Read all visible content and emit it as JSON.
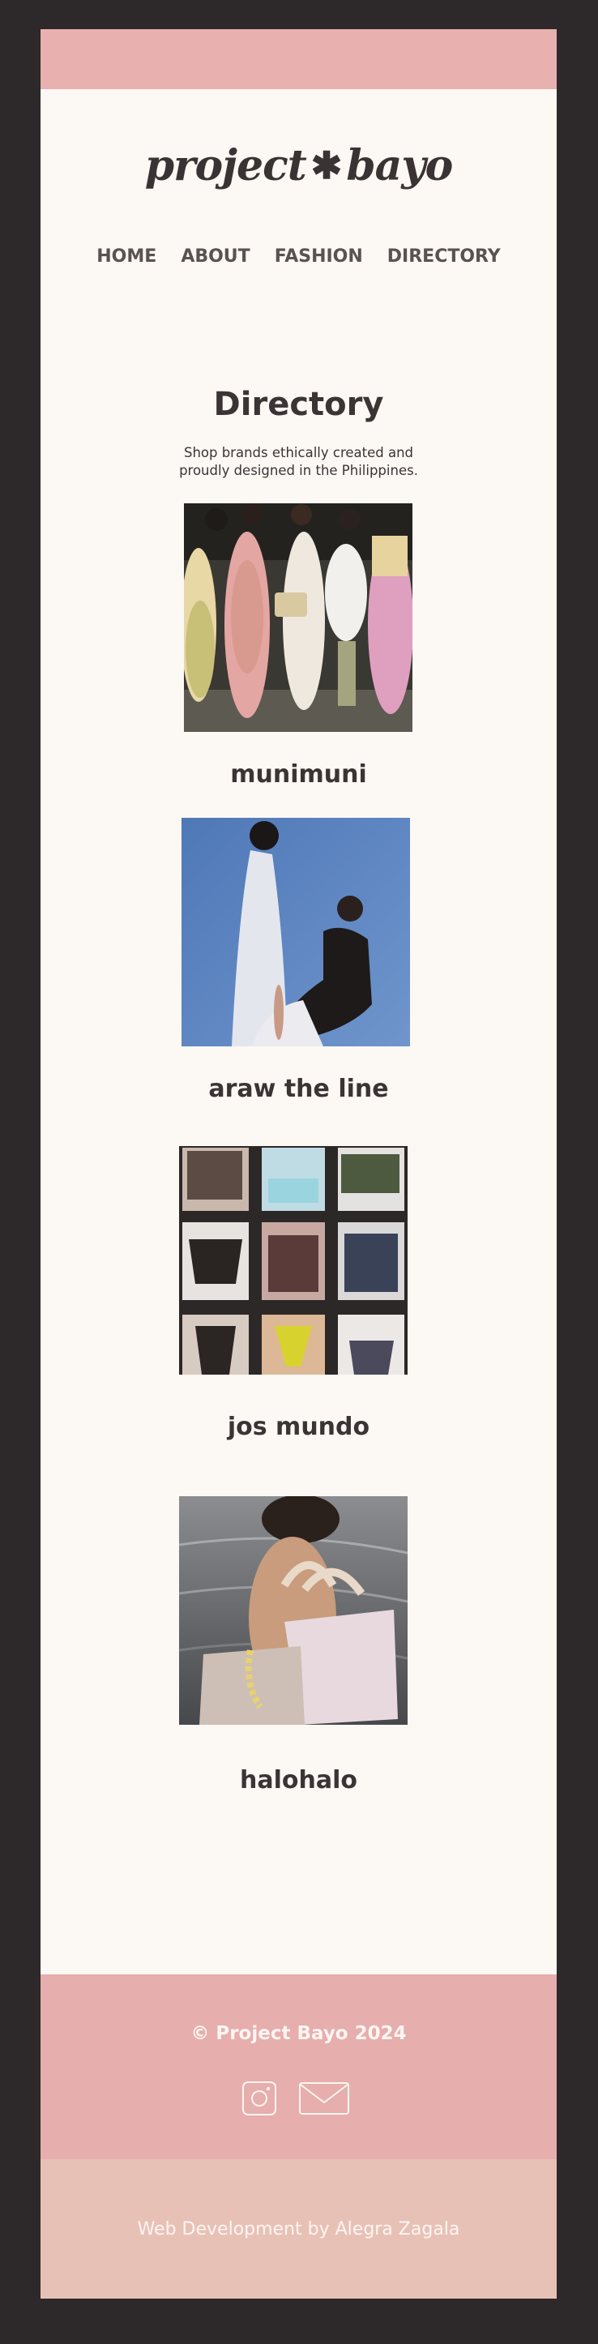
{
  "logo": {
    "part1": "project",
    "symbol": "✱",
    "part2": "bayo"
  },
  "nav": {
    "items": [
      "HOME",
      "ABOUT",
      "FASHION",
      "DIRECTORY"
    ]
  },
  "header": {
    "title": "Directory",
    "subtitle_line1": "Shop brands ethically created and",
    "subtitle_line2": "proudly designed in the Philippines."
  },
  "brands": [
    {
      "name": "munimuni"
    },
    {
      "name": "araw the line"
    },
    {
      "name": "jos mundo"
    },
    {
      "name": "halohalo"
    }
  ],
  "footer": {
    "copyright": "© Project Bayo 2024",
    "credit": "Web Development by Alegra Zagala"
  },
  "icons": {
    "instagram": "instagram-icon",
    "email": "email-icon"
  },
  "colors": {
    "frame": "#2d2829",
    "page": "#fcf8f4",
    "accent_pink": "#e8b0ae",
    "footer_bottom": "#e8c1b6",
    "text_dark": "#3b3435"
  }
}
